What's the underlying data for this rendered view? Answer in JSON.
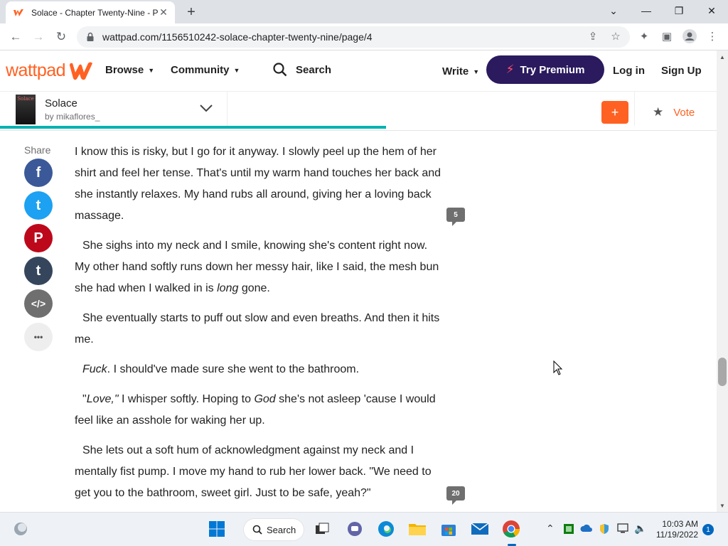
{
  "browser": {
    "tab_title": "Solace - Chapter Twenty-Nine - P",
    "url": "wattpad.com/1156510242-solace-chapter-twenty-nine/page/4",
    "new_tab_label": "+",
    "win_minimize": "—",
    "win_restore": "❐",
    "win_close": "✕",
    "tab_close": "✕"
  },
  "header": {
    "logo_text": "wattpad",
    "browse": "Browse",
    "community": "Community",
    "search": "Search",
    "write": "Write",
    "premium": "Try Premium",
    "login": "Log in",
    "signup": "Sign Up"
  },
  "story": {
    "cover_text": "Solace",
    "title": "Solace",
    "author": "by mikaflores_",
    "add_label": "+",
    "vote_label": "Vote",
    "progress_fraction": 0.53
  },
  "share": {
    "label": "Share",
    "buttons": [
      {
        "name": "facebook",
        "glyph": "f",
        "color": "#3b5998"
      },
      {
        "name": "twitter",
        "glyph": "t",
        "color": "#1da1f2"
      },
      {
        "name": "pinterest",
        "glyph": "P",
        "color": "#bd081c"
      },
      {
        "name": "tumblr",
        "glyph": "t",
        "color": "#35465c"
      },
      {
        "name": "embed",
        "glyph": "</>",
        "color": "#6f6f6f"
      },
      {
        "name": "more",
        "glyph": "•••",
        "color": "#eeeeee"
      }
    ]
  },
  "paragraphs": [
    "I know this is risky, but I go for it anyway. I slowly peel up the hem of her shirt and feel her tense. That's until my warm hand touches her back and she instantly relaxes. My hand rubs all around, giving her a loving back massage.",
    "She sighs into my neck and I smile, knowing she's content right now. My other hand softly runs down her messy hair, like I said, the mesh bun she had when I walked in is",
    "long",
    "gone.",
    "She eventually starts to puff out slow and even breaths. And then it hits me.",
    "Fuck",
    ". I should've made sure she went to the bathroom.",
    "\"",
    "Love,\"",
    "I whisper softly. Hoping to",
    "God",
    "she's not asleep 'cause I would feel like an asshole for waking her up.",
    "She lets out a soft hum of acknowledgment against my neck and I mentally fist pump. I move my hand to rub her lower back. \"We need to get you to the bathroom, sweet girl. Just to be safe, yeah?\""
  ],
  "comments": {
    "first": "5",
    "second": "20"
  },
  "taskbar": {
    "search": "Search",
    "time": "10:03 AM",
    "date": "11/19/2022",
    "notifications": "1"
  }
}
